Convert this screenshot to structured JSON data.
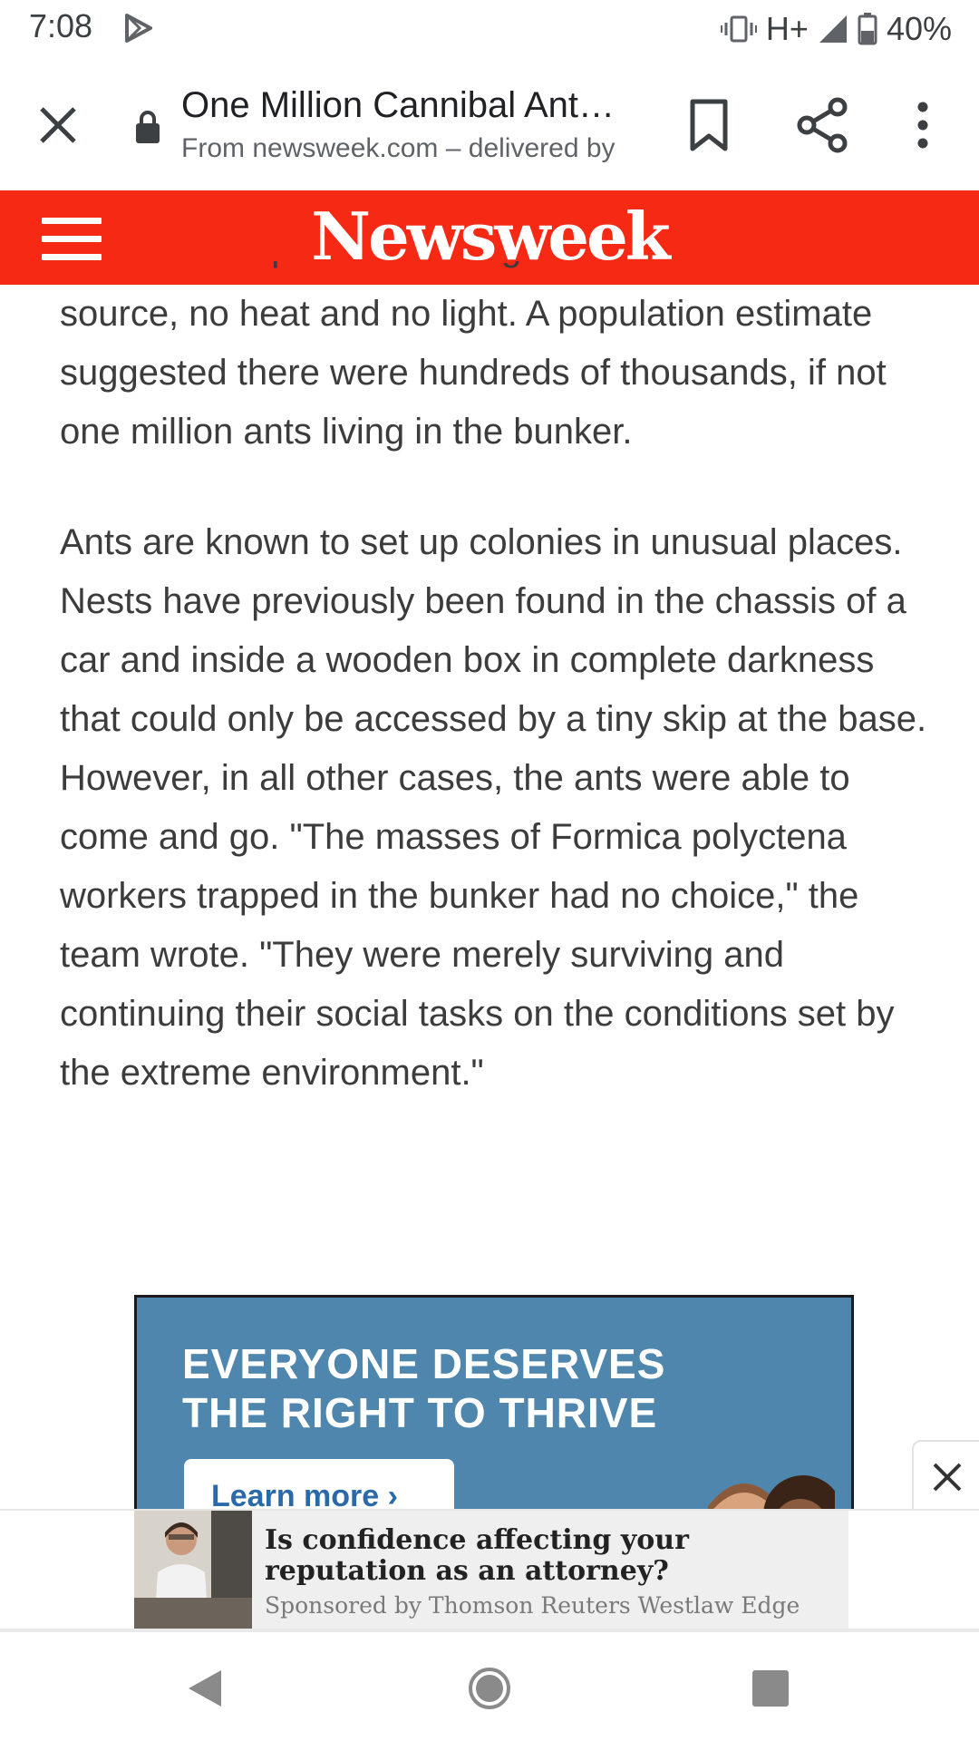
{
  "status_bar": {
    "time": "7:08",
    "network": "H+",
    "battery": "40%"
  },
  "toolbar": {
    "title": "One Million Cannibal Ant…",
    "subtitle": "From newsweek.com – delivered by"
  },
  "brand": {
    "logo": "Newsweek",
    "color": "#f52914"
  },
  "article": {
    "cut_line": "This was despite there being no obvious food",
    "paragraphs": [
      "source, no heat and no light. A population estimate suggested there were hundreds of thousands, if not one million ants living in the bunker.",
      "Ants are known to set up colonies in unusual places. Nests have previously been found in the chassis of a car and inside a wooden box in complete darkness that could only be accessed by a tiny skip at the base. However, in all other cases, the ants were able to come and go. \"The masses of Formica polyctena workers trapped in the bunker had no choice,\" the team wrote. \"They were merely surviving and continuing their social tasks on the conditions set by the extreme environment.\""
    ]
  },
  "ad": {
    "headline_line1": "EVERYONE DESERVES",
    "headline_line2": "THE RIGHT TO THRIVE",
    "cta": "Learn more ›"
  },
  "native_ad": {
    "title": "Is confidence affecting your reputation as an attorney?",
    "sponsor": "Sponsored by Thomson Reuters Westlaw Edge"
  }
}
